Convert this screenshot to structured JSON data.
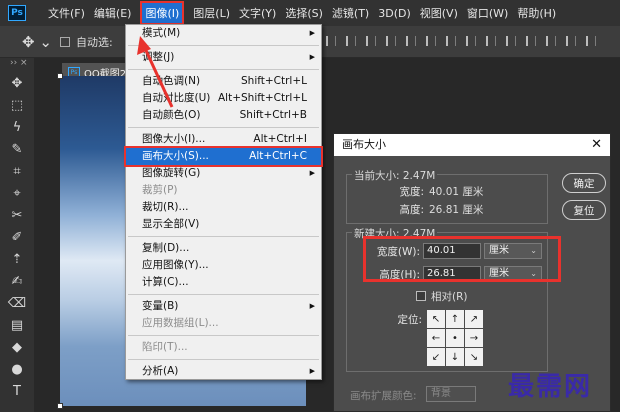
{
  "menubar": {
    "logo": "Ps",
    "items": [
      "文件(F)",
      "编辑(E)",
      "图像(I)",
      "图层(L)",
      "文字(Y)",
      "选择(S)",
      "滤镜(T)",
      "3D(D)",
      "视图(V)",
      "窗口(W)",
      "帮助(H)"
    ],
    "active_index": 2
  },
  "optbar": {
    "move_glyph": "✥ ⌄",
    "auto_select": "自动选:"
  },
  "doc_tab": {
    "title": "QQ截图20",
    "close": "×"
  },
  "toolbar": {
    "header": "›› ×",
    "tools": [
      "✥",
      "⬚",
      "ϟ",
      "✎",
      "⌗",
      "⌖",
      "✂",
      "✐",
      "⇡",
      "✍",
      "⌫",
      "▤",
      "◆",
      "●",
      "T"
    ]
  },
  "image_menu": {
    "items": [
      {
        "label": "模式(M)",
        "shortcut": "",
        "submenu": true,
        "disabled": false
      },
      {
        "sep": true
      },
      {
        "label": "调整(J)",
        "shortcut": "",
        "submenu": true,
        "disabled": false
      },
      {
        "sep": true
      },
      {
        "label": "自动色调(N)",
        "shortcut": "Shift+Ctrl+L",
        "submenu": false,
        "disabled": false
      },
      {
        "label": "自动对比度(U)",
        "shortcut": "Alt+Shift+Ctrl+L",
        "submenu": false,
        "disabled": false
      },
      {
        "label": "自动颜色(O)",
        "shortcut": "Shift+Ctrl+B",
        "submenu": false,
        "disabled": false
      },
      {
        "sep": true
      },
      {
        "label": "图像大小(I)...",
        "shortcut": "Alt+Ctrl+I",
        "submenu": false,
        "disabled": false
      },
      {
        "label": "画布大小(S)...",
        "shortcut": "Alt+Ctrl+C",
        "submenu": false,
        "disabled": false,
        "highlighted": true
      },
      {
        "label": "图像旋转(G)",
        "shortcut": "",
        "submenu": true,
        "disabled": false
      },
      {
        "label": "裁剪(P)",
        "shortcut": "",
        "submenu": false,
        "disabled": true
      },
      {
        "label": "裁切(R)...",
        "shortcut": "",
        "submenu": false,
        "disabled": false
      },
      {
        "label": "显示全部(V)",
        "shortcut": "",
        "submenu": false,
        "disabled": false
      },
      {
        "sep": true
      },
      {
        "label": "复制(D)...",
        "shortcut": "",
        "submenu": false,
        "disabled": false
      },
      {
        "label": "应用图像(Y)...",
        "shortcut": "",
        "submenu": false,
        "disabled": false
      },
      {
        "label": "计算(C)...",
        "shortcut": "",
        "submenu": false,
        "disabled": false
      },
      {
        "sep": true
      },
      {
        "label": "变量(B)",
        "shortcut": "",
        "submenu": true,
        "disabled": false
      },
      {
        "label": "应用数据组(L)...",
        "shortcut": "",
        "submenu": false,
        "disabled": true
      },
      {
        "sep": true
      },
      {
        "label": "陷印(T)...",
        "shortcut": "",
        "submenu": false,
        "disabled": true
      },
      {
        "sep": true
      },
      {
        "label": "分析(A)",
        "shortcut": "",
        "submenu": true,
        "disabled": false
      }
    ]
  },
  "dialog": {
    "title": "画布大小",
    "close": "✕",
    "current_size": "当前大小: 2.47M",
    "width_label": "宽度:",
    "width_value": "40.01 厘米",
    "height_label": "高度:",
    "height_value": "26.81 厘米",
    "new_size": "新建大小: 2.47M",
    "new_width_label": "宽度(W):",
    "new_width_value": "40.01",
    "new_height_label": "高度(H):",
    "new_height_value": "26.81",
    "unit": "厘米",
    "relative_label": "相对(R)",
    "anchor_label": "定位:",
    "anchor_glyphs": [
      "↖",
      "↑",
      "↗",
      "←",
      "•",
      "→",
      "↙",
      "↓",
      "↘"
    ],
    "extension_label": "画布扩展颜色:",
    "extension_value": "背景",
    "ok": "确定",
    "reset": "复位"
  },
  "watermark": "最需网",
  "colors": {
    "accent": "#1f6fd0",
    "annotation_red": "#e8322d"
  }
}
